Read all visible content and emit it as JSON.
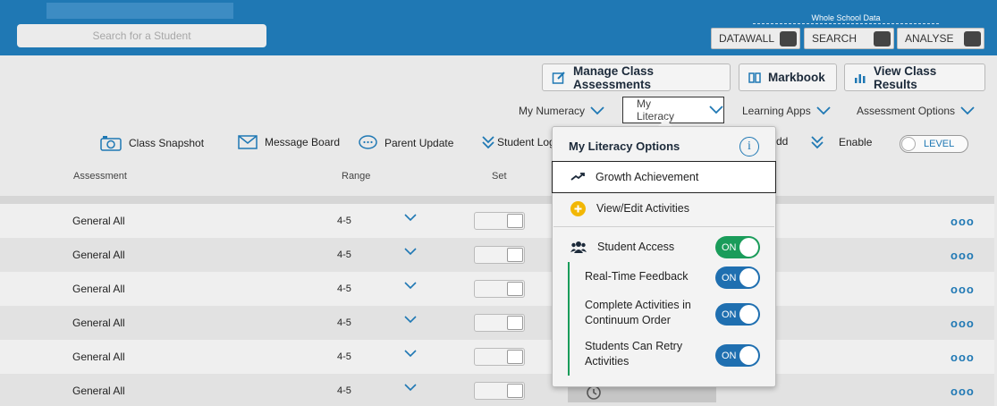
{
  "header": {
    "search_placeholder": "Search for a Student",
    "whole_school_label": "Whole School Data",
    "buttons": [
      {
        "label": "DATAWALL"
      },
      {
        "label": "SEARCH"
      },
      {
        "label": "ANALYSE"
      }
    ]
  },
  "actions": {
    "manage": "Manage Class Assessments",
    "markbook": "Markbook",
    "view_results": "View Class Results"
  },
  "menus": {
    "numeracy": "My Numeracy",
    "literacy": "My Literacy",
    "apps": "Learning Apps",
    "assessment": "Assessment Options"
  },
  "tools": {
    "snapshot": "Class Snapshot",
    "message": "Message Board",
    "parent": "Parent Update",
    "student_log": "Student Log",
    "add": "dd",
    "enable": "Enable",
    "level": "LEVEL"
  },
  "columns": {
    "assessment": "Assessment",
    "range": "Range",
    "set": "Set"
  },
  "rows": [
    {
      "name": "General All",
      "range": "4-5"
    },
    {
      "name": "General All",
      "range": "4-5"
    },
    {
      "name": "General All",
      "range": "4-5"
    },
    {
      "name": "General All",
      "range": "4-5"
    },
    {
      "name": "General All",
      "range": "4-5"
    },
    {
      "name": "General All",
      "range": "4-5"
    }
  ],
  "dots": "ooo",
  "dropdown": {
    "title": "My Literacy Options",
    "info": "i",
    "growth": "Growth Achievement",
    "view_edit": "View/Edit Activities",
    "student_access": "Student Access",
    "realtime": "Real-Time Feedback",
    "complete_line1": "Complete Activities in",
    "complete_line2": "Continuum Order",
    "retry_line1": "Students Can Retry",
    "retry_line2": "Activities",
    "on": "ON"
  },
  "colors": {
    "header_blue": "#1f78b4",
    "switch_green": "#1a9c5a",
    "switch_blue": "#1f6fb0",
    "plus_yellow": "#f2b705"
  }
}
